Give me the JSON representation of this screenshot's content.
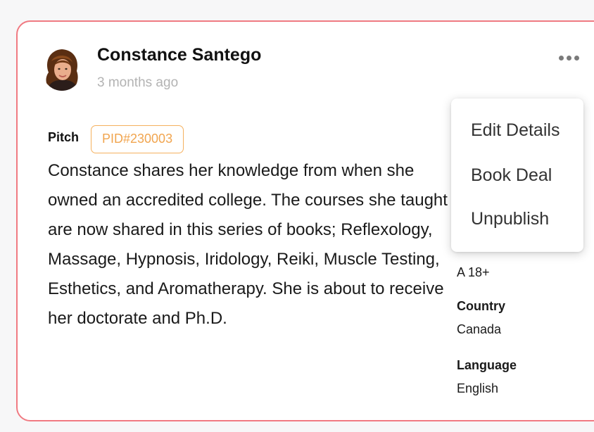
{
  "post": {
    "author_name": "Constance Santego",
    "timestamp": "3 months ago",
    "pitch_label": "Pitch",
    "pid": "PID#230003",
    "pitch_text": "Constance shares her knowledge from when she owned an accredited college. The courses she taught are now shared in this series of books; Reflexology, Massage, Hypnosis, Iridology, Reiki, Muscle Testing, Esthetics, and Aromatherapy. She is about to receive her doctorate and Ph.D."
  },
  "details": {
    "category_value": "A 18+",
    "country_label": "Country",
    "country_value": "Canada",
    "language_label": "Language",
    "language_value": "English"
  },
  "menu": {
    "icon": "more-horizontal-icon",
    "items": [
      {
        "label": "Edit Details"
      },
      {
        "label": "Book Deal"
      },
      {
        "label": "Unpublish"
      }
    ]
  },
  "colors": {
    "card_border": "#f07a82",
    "badge_accent": "#f1a54f",
    "timestamp": "#b3b3b3"
  }
}
